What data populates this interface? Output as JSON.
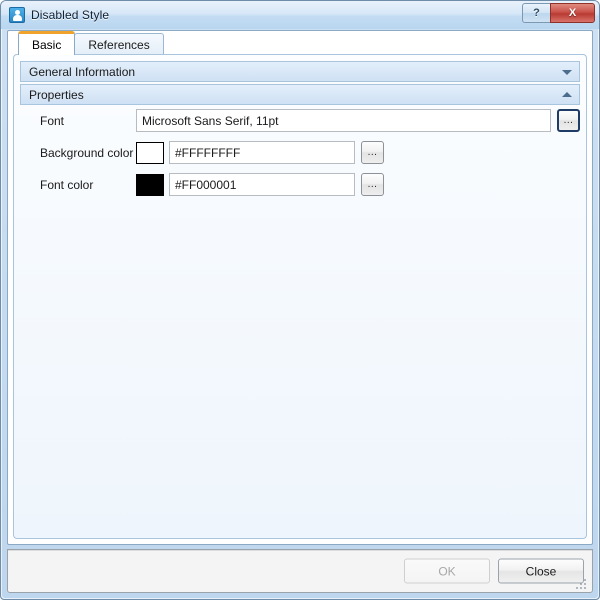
{
  "window": {
    "title": "Disabled Style",
    "icon": "app-icon",
    "controls": {
      "help_label": "?",
      "close_label": "X"
    }
  },
  "tabs": [
    {
      "label": "Basic",
      "active": true
    },
    {
      "label": "References",
      "active": false
    }
  ],
  "sections": [
    {
      "label": "General Information",
      "expanded": false,
      "chevron": "chevron-down-icon"
    },
    {
      "label": "Properties",
      "expanded": true,
      "chevron": "chevron-up-icon"
    }
  ],
  "form": {
    "rows": [
      {
        "label": "Font",
        "value": "Microsoft Sans Serif, 11pt",
        "swatch": null,
        "browse_label": "...",
        "focused": true
      },
      {
        "label": "Background color",
        "value": "#FFFFFFFF",
        "swatch": "#FFFFFF",
        "browse_label": "...",
        "focused": false
      },
      {
        "label": "Font color",
        "value": "#FF000001",
        "swatch": "#000000",
        "browse_label": "...",
        "focused": false
      }
    ]
  },
  "footer": {
    "ok_label": "OK",
    "ok_enabled": false,
    "close_label": "Close",
    "close_enabled": true
  },
  "colors": {
    "accent_tab": "#F0A32A",
    "titlebar_start": "#E9F2FB",
    "titlebar_end": "#B9D6F0",
    "close_button": "#C9524A",
    "section_header": "#CFE1F4",
    "focus_border": "#1F3C66"
  }
}
